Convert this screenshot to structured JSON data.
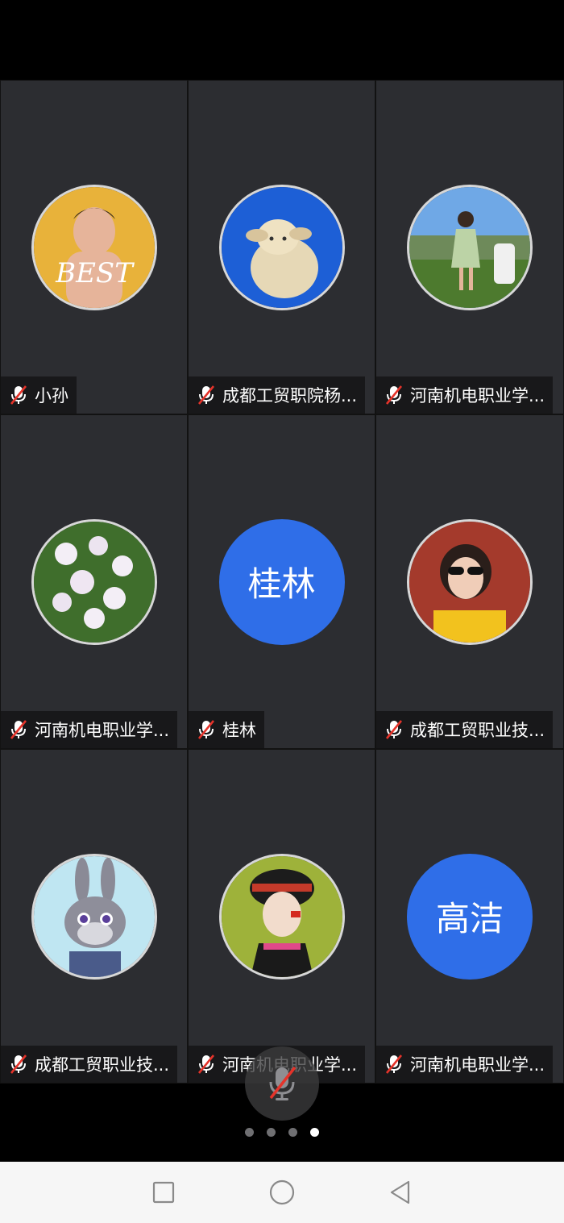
{
  "participants": [
    {
      "name": "小孙",
      "avatar": "photo-boy-best",
      "initials": "",
      "muted": true
    },
    {
      "name": "成都工贸职院杨...",
      "avatar": "photo-plush-sheep",
      "initials": "",
      "muted": true
    },
    {
      "name": "河南机电职业学...",
      "avatar": "photo-girl-garden",
      "initials": "",
      "muted": true
    },
    {
      "name": "河南机电职业学...",
      "avatar": "photo-white-flowers",
      "initials": "",
      "muted": true
    },
    {
      "name": "桂林",
      "avatar": "initials",
      "initials": "桂林",
      "muted": true
    },
    {
      "name": "成都工贸职业技...",
      "avatar": "photo-girl-sunglasses",
      "initials": "",
      "muted": true
    },
    {
      "name": "成都工贸职业技...",
      "avatar": "photo-cartoon-bunny",
      "initials": "",
      "muted": true
    },
    {
      "name": "河南机电职业学...",
      "avatar": "photo-girl-headdress",
      "initials": "",
      "muted": true
    },
    {
      "name": "河南机电职业学...",
      "avatar": "initials",
      "initials": "高洁",
      "muted": true
    }
  ],
  "pager": {
    "total": 4,
    "active_index": 3
  },
  "colors": {
    "tile_bg": "#2c2d31",
    "initials_bg": "#2f6ee8",
    "muted_red": "#e5332a"
  },
  "navbar": {
    "buttons": [
      "recents-square-icon",
      "home-circle-icon",
      "back-triangle-icon"
    ]
  }
}
